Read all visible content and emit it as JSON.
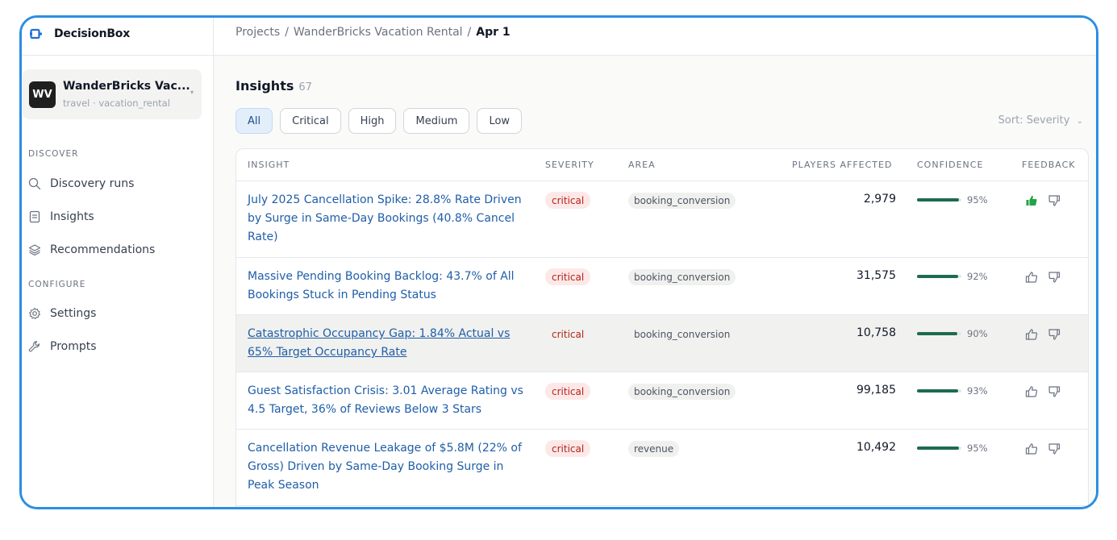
{
  "app": {
    "name": "DecisionBox"
  },
  "project": {
    "initials": "WV",
    "name": "WanderBricks Vac...",
    "subtitle": "travel · vacation_rental"
  },
  "sidebar": {
    "discover_label": "DISCOVER",
    "configure_label": "CONFIGURE",
    "items": [
      {
        "label": "Discovery runs",
        "icon": "search-icon"
      },
      {
        "label": "Insights",
        "icon": "document-icon"
      },
      {
        "label": "Recommendations",
        "icon": "layers-icon"
      },
      {
        "label": "Settings",
        "icon": "gear-icon"
      },
      {
        "label": "Prompts",
        "icon": "wrench-icon"
      }
    ]
  },
  "breadcrumb": {
    "root": "Projects",
    "sep": "/",
    "project": "WanderBricks Vacation Rental",
    "current": "Apr 1"
  },
  "insights": {
    "title": "Insights",
    "count": "67",
    "filters": [
      "All",
      "Critical",
      "High",
      "Medium",
      "Low"
    ],
    "active_filter": "All",
    "sort_label": "Sort: Severity"
  },
  "table": {
    "columns": {
      "insight": "INSIGHT",
      "severity": "SEVERITY",
      "area": "AREA",
      "players": "PLAYERS AFFECTED",
      "confidence": "CONFIDENCE",
      "feedback": "FEEDBACK"
    },
    "rows": [
      {
        "title": "July 2025 Cancellation Spike: 28.8% Rate Driven by Surge in Same-Day Bookings (40.8% Cancel Rate)",
        "severity": "critical",
        "area": "booking_conversion",
        "players": "2,979",
        "confidence": "95%",
        "confidence_value": 0.95,
        "feedback": "up"
      },
      {
        "title": "Massive Pending Booking Backlog: 43.7% of All Bookings Stuck in Pending Status",
        "severity": "critical",
        "area": "booking_conversion",
        "players": "31,575",
        "confidence": "92%",
        "confidence_value": 0.92,
        "feedback": "none"
      },
      {
        "title": "Catastrophic Occupancy Gap: 1.84% Actual vs 65% Target Occupancy Rate",
        "severity": "critical",
        "area": "booking_conversion",
        "players": "10,758",
        "confidence": "90%",
        "confidence_value": 0.9,
        "feedback": "none"
      },
      {
        "title": "Guest Satisfaction Crisis: 3.01 Average Rating vs 4.5 Target, 36% of Reviews Below 3 Stars",
        "severity": "critical",
        "area": "booking_conversion",
        "players": "99,185",
        "confidence": "93%",
        "confidence_value": 0.93,
        "feedback": "none"
      },
      {
        "title": "Cancellation Revenue Leakage of $5.8M (22% of Gross) Driven by Same-Day Booking Surge in Peak Season",
        "severity": "critical",
        "area": "revenue",
        "players": "10,492",
        "confidence": "95%",
        "confidence_value": 0.95,
        "feedback": "none"
      }
    ]
  },
  "colors": {
    "accent": "#2b8ee3",
    "link": "#1f5ea8",
    "critical_bg": "#fde8e8",
    "critical_fg": "#b42318",
    "confidence": "#1d6b50",
    "thumb_active": "#22a447"
  }
}
